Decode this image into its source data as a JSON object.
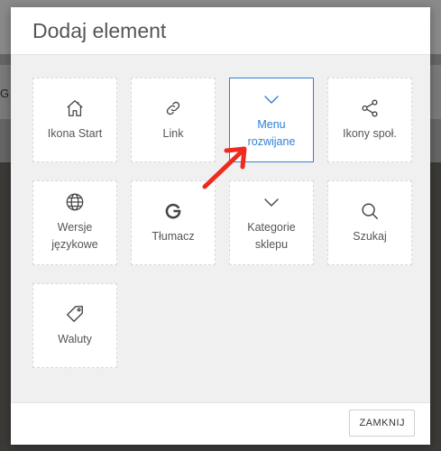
{
  "backdrop": {
    "left_text": "G"
  },
  "dialog": {
    "title": "Dodaj element",
    "close_label": "ZAMKNIJ"
  },
  "tiles": [
    {
      "label": "Ikona Start",
      "icon": "home-icon"
    },
    {
      "label": "Link",
      "icon": "link-icon"
    },
    {
      "label": "Menu rozwijane",
      "icon": "chevron-down-icon",
      "selected": true
    },
    {
      "label": "Ikony społ.",
      "icon": "share-icon"
    },
    {
      "label": "Wersje językowe",
      "icon": "globe-icon"
    },
    {
      "label": "Tłumacz",
      "icon": "google-icon"
    },
    {
      "label": "Kategorie sklepu",
      "icon": "chevron-down-icon"
    },
    {
      "label": "Szukaj",
      "icon": "search-icon"
    },
    {
      "label": "Waluty",
      "icon": "tag-icon"
    }
  ],
  "colors": {
    "accent": "#2f80d6",
    "annotation_arrow": "#ee2b1e"
  }
}
